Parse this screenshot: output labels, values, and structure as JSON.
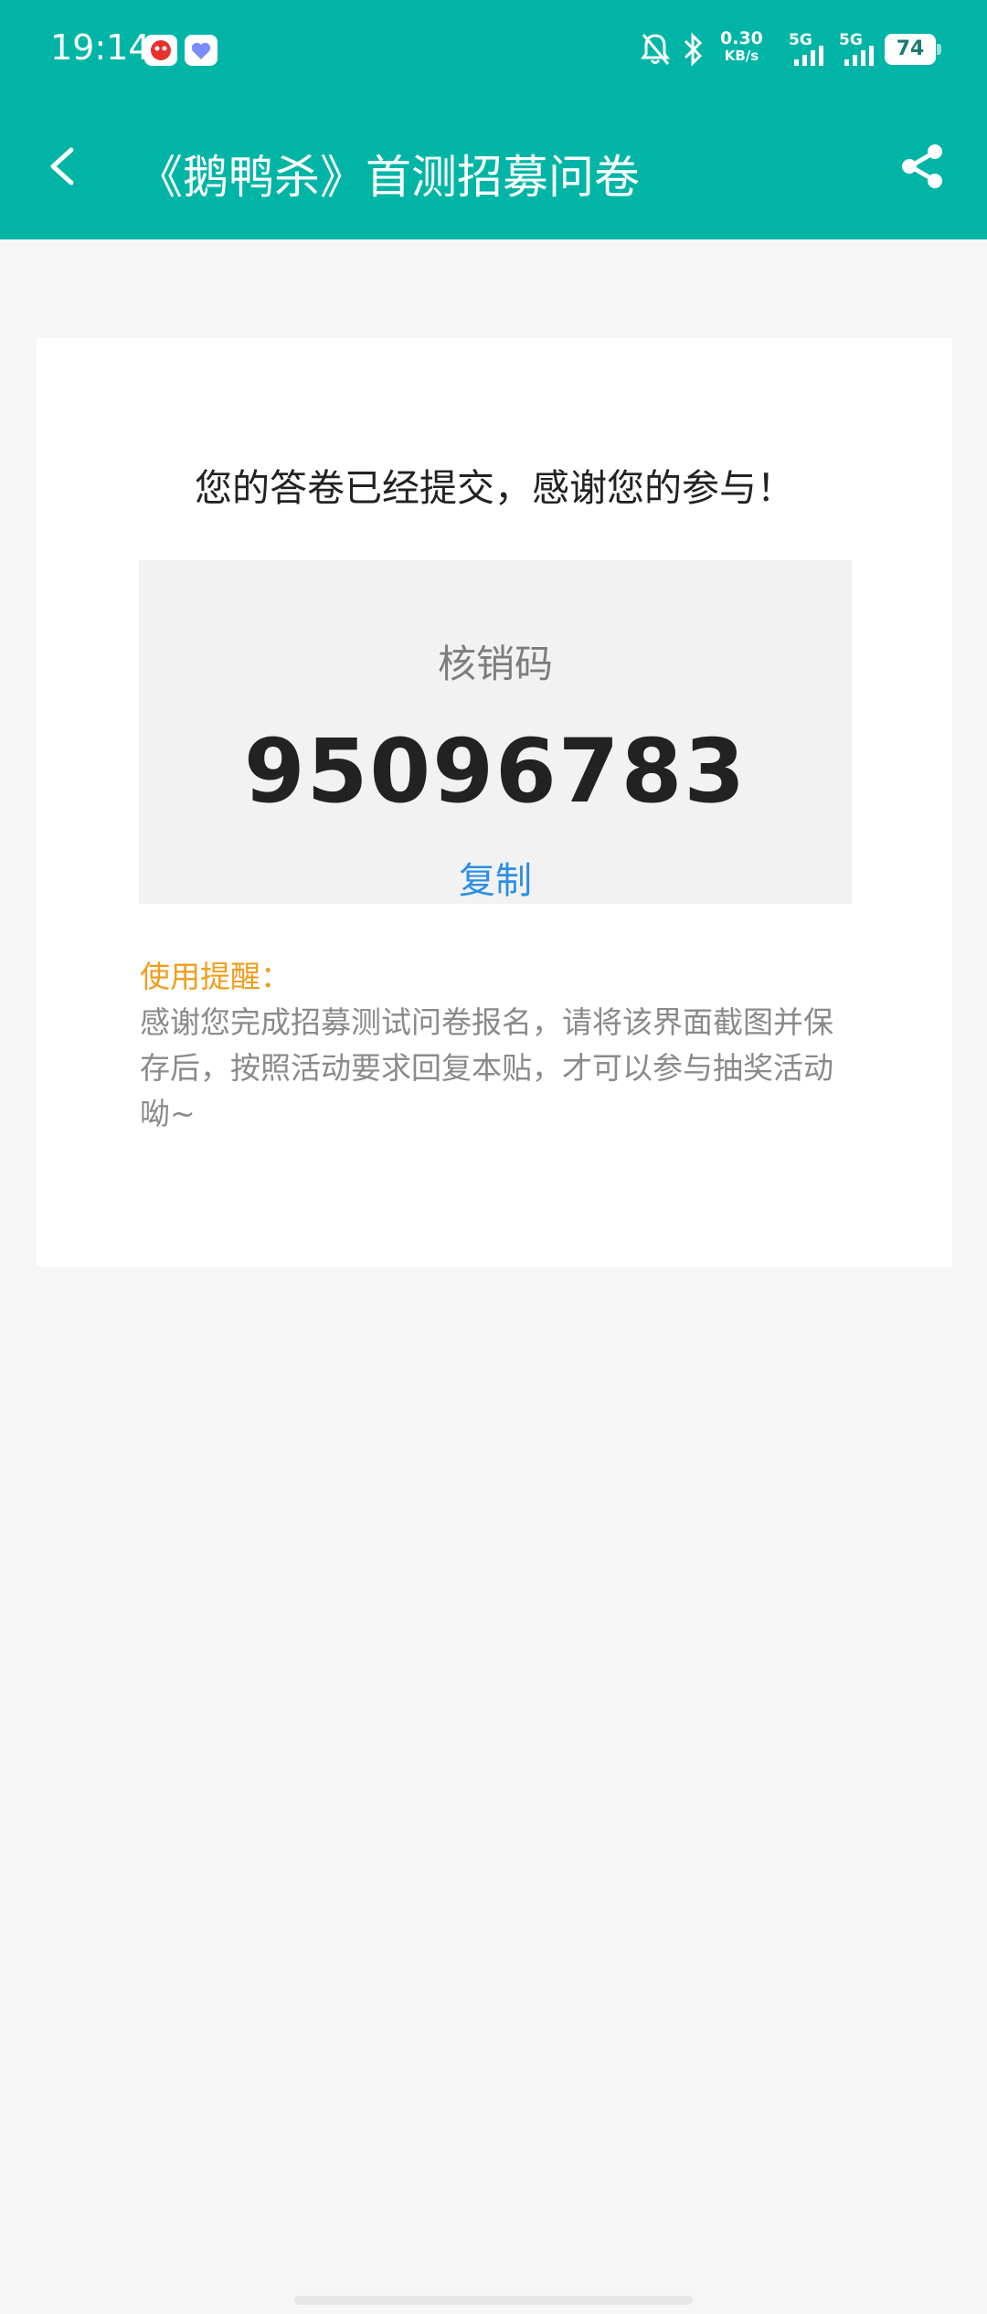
{
  "status_bar": {
    "time": "19:14",
    "net_speed_value": "0.30",
    "net_speed_unit": "KB/s",
    "sim1_label": "5G",
    "sim2_label": "5G",
    "battery_level": "74"
  },
  "nav": {
    "title": "《鹅鸭杀》首测招募问卷",
    "back_icon": "chevron-left-icon",
    "share_icon": "share-icon"
  },
  "result_card": {
    "thanks_message": "您的答卷已经提交，感谢您的参与！",
    "code_label": "核销码",
    "code_value": "95096783",
    "copy_label": "复制",
    "reminder_title": "使用提醒：",
    "reminder_body": "感谢您完成招募测试问卷报名，请将该界面截图并保存后，按照活动要求回复本贴，才可以参与抽奖活动呦~"
  },
  "colors": {
    "header": "#00b5a6",
    "copy_link": "#2a8fe6",
    "reminder_title": "#f19d1c"
  }
}
